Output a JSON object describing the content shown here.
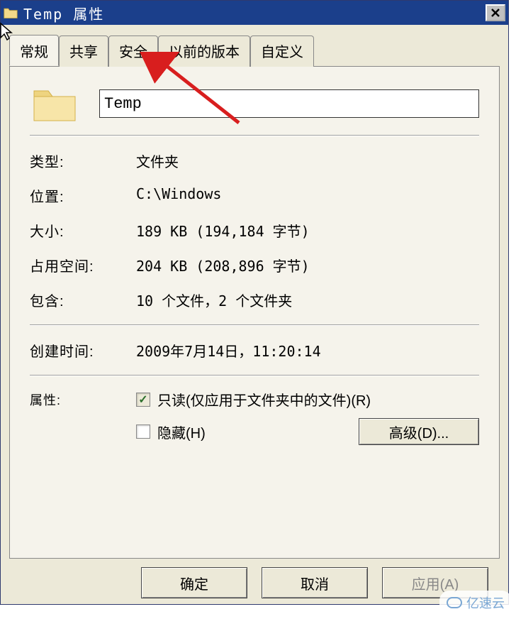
{
  "titlebar": {
    "title": "Temp 属性"
  },
  "tabs": {
    "general": "常规",
    "sharing": "共享",
    "security": "安全",
    "previous": "以前的版本",
    "custom": "自定义"
  },
  "folder": {
    "name": "Temp"
  },
  "rows": {
    "type_label": "类型:",
    "type_value": "文件夹",
    "location_label": "位置:",
    "location_value": "C:\\Windows",
    "size_label": "大小:",
    "size_value": "189 KB (194,184 字节)",
    "size_on_disk_label": "占用空间:",
    "size_on_disk_value": "204 KB (208,896 字节)",
    "contains_label": "包含:",
    "contains_value": "10 个文件，2 个文件夹",
    "created_label": "创建时间:",
    "created_value": "2009年7月14日，11:20:14"
  },
  "attributes": {
    "label": "属性:",
    "readonly": "只读(仅应用于文件夹中的文件)(R)",
    "hidden": "隐藏(H)",
    "advanced": "高级(D)..."
  },
  "buttons": {
    "ok": "确定",
    "cancel": "取消",
    "apply": "应用(A)"
  },
  "watermark": "亿速云"
}
